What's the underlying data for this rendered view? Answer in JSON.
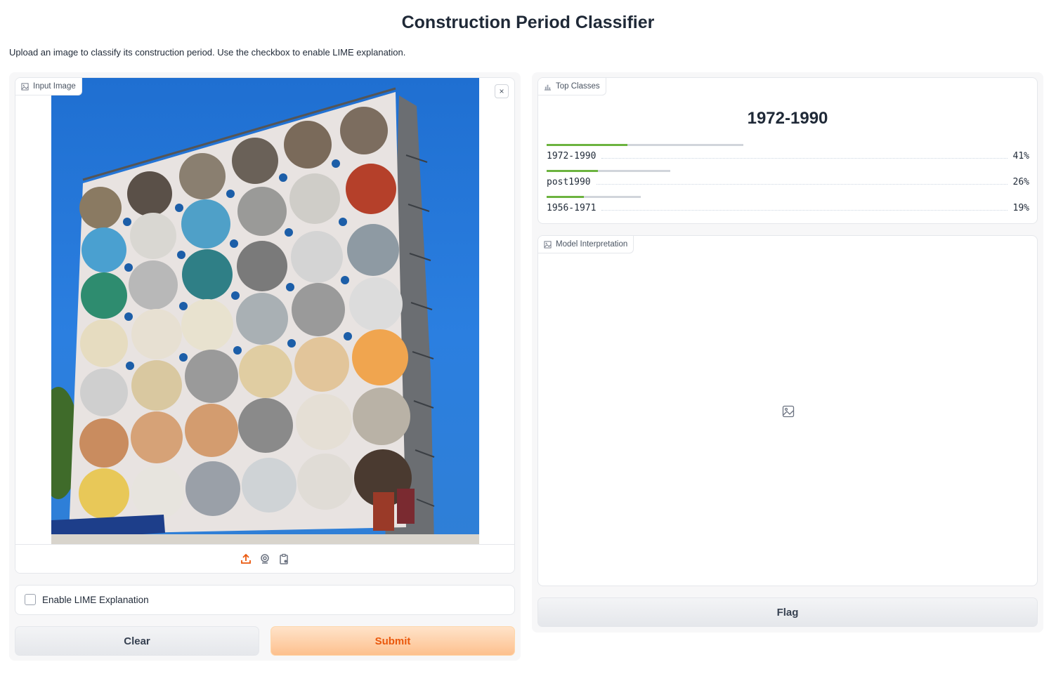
{
  "page": {
    "title": "Construction Period Classifier",
    "description": "Upload an image to classify its construction period. Use the checkbox to enable LIME explanation."
  },
  "input_panel": {
    "image_label": "Input Image",
    "image_description": "Building with round openings and colorful curtains under blue sky",
    "close_icon": "×",
    "toolbar_icons": [
      "upload-icon",
      "webcam-icon",
      "clipboard-icon"
    ],
    "lime_checkbox": {
      "label": "Enable LIME Explanation",
      "checked": false
    },
    "clear_label": "Clear",
    "submit_label": "Submit"
  },
  "output_panel": {
    "label_title": "Top Classes",
    "top_prediction": "1972-1990",
    "confidences": [
      {
        "label": "1972-1990",
        "percent": "41%",
        "value": 0.41
      },
      {
        "label": "post1990",
        "percent": "26%",
        "value": 0.26
      },
      {
        "label": "1956-1971",
        "percent": "19%",
        "value": 0.19
      }
    ],
    "interpretation_label": "Model Interpretation",
    "flag_label": "Flag"
  },
  "colors": {
    "accent": "#ea580c",
    "confidence_bar": "#6cb33f",
    "track": "#d1d5db"
  }
}
